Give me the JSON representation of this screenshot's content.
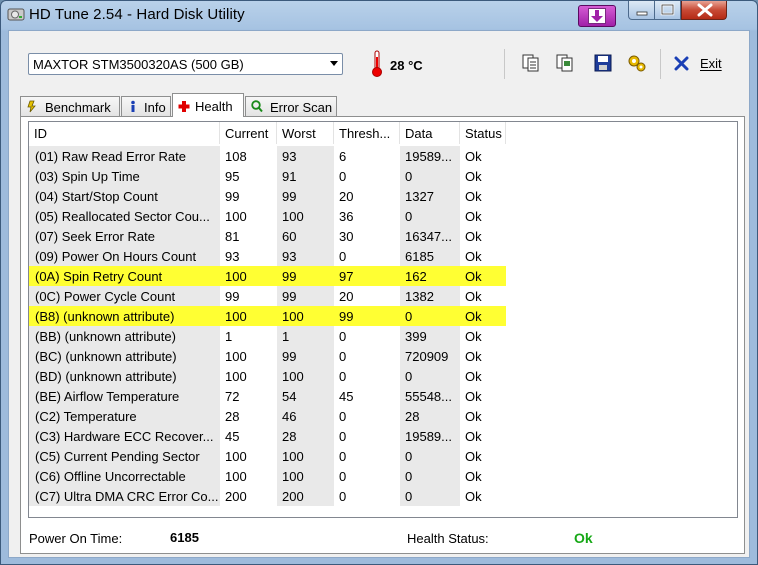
{
  "window": {
    "title": "HD Tune 2.54 - Hard Disk Utility"
  },
  "toolbar": {
    "drive": "MAXTOR STM3500320AS (500 GB)",
    "temperature": "28 °C",
    "exit_label": "Exit"
  },
  "tabs": [
    {
      "label": "Benchmark",
      "icon": "benchmark-icon"
    },
    {
      "label": "Info",
      "icon": "info-icon"
    },
    {
      "label": "Health",
      "icon": "health-cross-icon",
      "active": true
    },
    {
      "label": "Error Scan",
      "icon": "error-scan-icon"
    }
  ],
  "table": {
    "columns": [
      "ID",
      "Current",
      "Worst",
      "Thresh...",
      "Data",
      "Status"
    ],
    "rows": [
      {
        "cells": [
          "(01) Raw Read Error Rate",
          "108",
          "93",
          "6",
          "19589...",
          "Ok"
        ]
      },
      {
        "cells": [
          "(03) Spin Up Time",
          "95",
          "91",
          "0",
          "0",
          "Ok"
        ]
      },
      {
        "cells": [
          "(04) Start/Stop Count",
          "99",
          "99",
          "20",
          "1327",
          "Ok"
        ]
      },
      {
        "cells": [
          "(05) Reallocated Sector Cou...",
          "100",
          "100",
          "36",
          "0",
          "Ok"
        ]
      },
      {
        "cells": [
          "(07) Seek Error Rate",
          "81",
          "60",
          "30",
          "16347...",
          "Ok"
        ]
      },
      {
        "cells": [
          "(09) Power On Hours Count",
          "93",
          "93",
          "0",
          "6185",
          "Ok"
        ]
      },
      {
        "cells": [
          "(0A) Spin Retry Count",
          "100",
          "99",
          "97",
          "162",
          "Ok"
        ],
        "highlight": true
      },
      {
        "cells": [
          "(0C) Power Cycle Count",
          "99",
          "99",
          "20",
          "1382",
          "Ok"
        ]
      },
      {
        "cells": [
          "(B8) (unknown attribute)",
          "100",
          "100",
          "99",
          "0",
          "Ok"
        ],
        "highlight": true
      },
      {
        "cells": [
          "(BB) (unknown attribute)",
          "1",
          "1",
          "0",
          "399",
          "Ok"
        ]
      },
      {
        "cells": [
          "(BC) (unknown attribute)",
          "100",
          "99",
          "0",
          "720909",
          "Ok"
        ]
      },
      {
        "cells": [
          "(BD) (unknown attribute)",
          "100",
          "100",
          "0",
          "0",
          "Ok"
        ]
      },
      {
        "cells": [
          "(BE) Airflow Temperature",
          "72",
          "54",
          "45",
          "55548...",
          "Ok"
        ]
      },
      {
        "cells": [
          "(C2) Temperature",
          "28",
          "46",
          "0",
          "28",
          "Ok"
        ]
      },
      {
        "cells": [
          "(C3) Hardware ECC Recover...",
          "45",
          "28",
          "0",
          "19589...",
          "Ok"
        ]
      },
      {
        "cells": [
          "(C5) Current Pending Sector",
          "100",
          "100",
          "0",
          "0",
          "Ok"
        ]
      },
      {
        "cells": [
          "(C6) Offline Uncorrectable",
          "100",
          "100",
          "0",
          "0",
          "Ok"
        ]
      },
      {
        "cells": [
          "(C7) Ultra DMA CRC Error Co...",
          "200",
          "200",
          "0",
          "0",
          "Ok"
        ]
      }
    ]
  },
  "status": {
    "power_on_label": "Power On Time:",
    "power_on_value": "6185",
    "health_label": "Health Status:",
    "health_value": "Ok"
  },
  "colors": {
    "highlight": "#ffff33",
    "health_ok": "#16a816"
  }
}
